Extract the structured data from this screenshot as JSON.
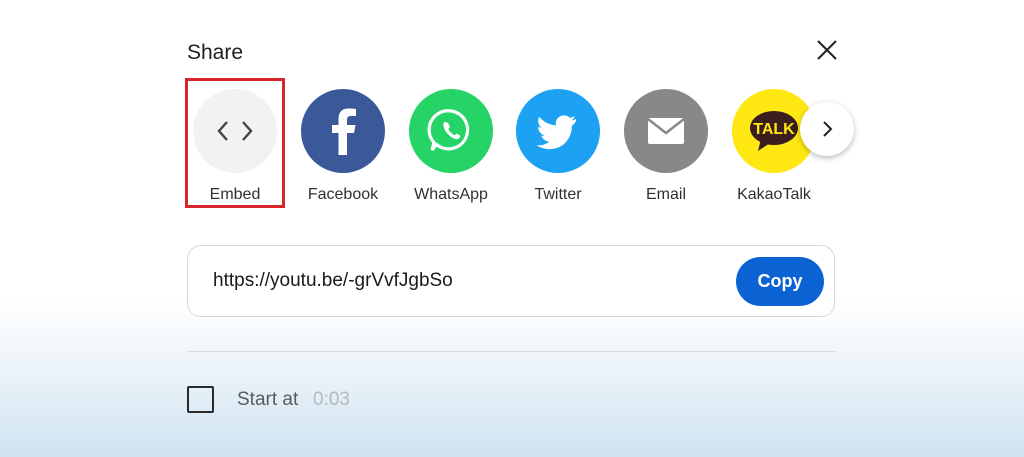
{
  "dialog": {
    "title": "Share"
  },
  "share_options": [
    {
      "label": "Embed",
      "icon": "embed-code-icon",
      "color": "#f2f2f2"
    },
    {
      "label": "Facebook",
      "icon": "facebook-icon",
      "color": "#3b5998"
    },
    {
      "label": "WhatsApp",
      "icon": "whatsapp-icon",
      "color": "#25d366"
    },
    {
      "label": "Twitter",
      "icon": "twitter-bird-icon",
      "color": "#1da1f2"
    },
    {
      "label": "Email",
      "icon": "email-envelope-icon",
      "color": "#888888"
    },
    {
      "label": "KakaoTalk",
      "icon": "kakaotalk-icon",
      "color": "#ffe812",
      "icon_text": "TALK"
    }
  ],
  "url": {
    "value": "https://youtu.be/-grVvfJgbSo",
    "copy_label": "Copy",
    "copy_color": "#0b63d3"
  },
  "start_at": {
    "label": "Start at",
    "time": "0:03",
    "checked": false
  },
  "highlight_color": "#d9262a"
}
